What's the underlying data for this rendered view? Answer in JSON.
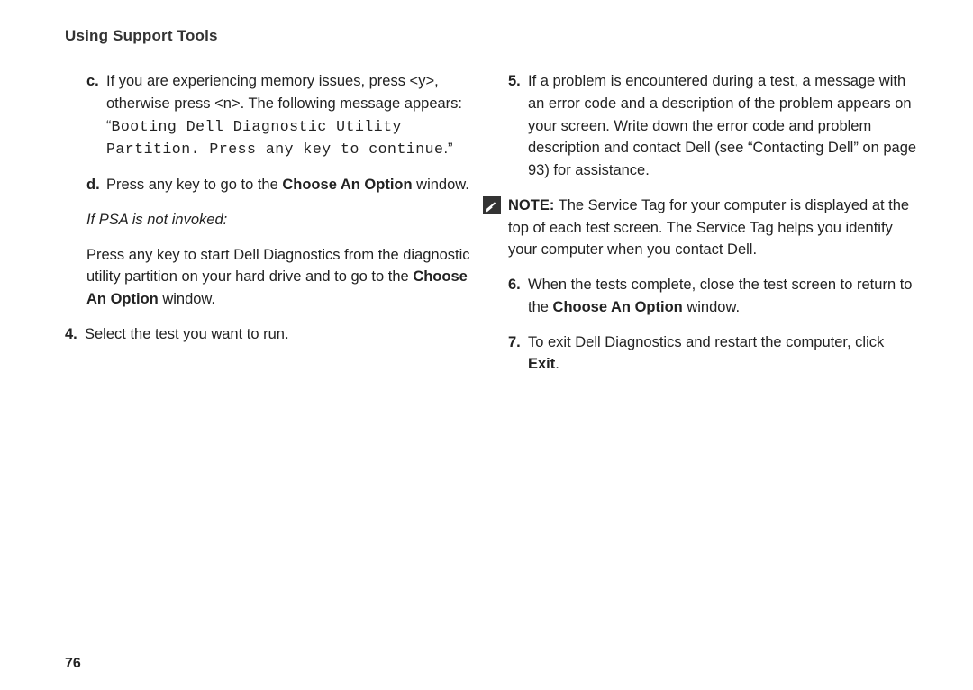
{
  "header": "Using Support Tools",
  "page_number": "76",
  "left": {
    "item_c": {
      "marker": "c.",
      "pre": "If you are experiencing memory issues, press <y>, otherwise press <n>. The following message appears: “",
      "mono": "Booting Dell Diagnostic Utility Partition. Press any key to continue",
      "post": ".”"
    },
    "item_d": {
      "marker": "d.",
      "t1": "Press any key to go to the ",
      "bold": "Choose An Option",
      "t2": " window."
    },
    "psa_heading": "If PSA is not invoked:",
    "psa_body": {
      "t1": "Press any key to start Dell Diagnostics from the diagnostic utility partition on your hard drive and to go to the ",
      "bold": "Choose An Option",
      "t2": " window."
    },
    "item_4": {
      "marker": "4.",
      "text": "Select the test you want to run."
    }
  },
  "right": {
    "item_5": {
      "marker": "5.",
      "text": "If a problem is encountered during a test, a message with an error code and a description of the problem appears on your screen. Write down the error code and problem description and contact Dell (see “Contacting Dell” on page 93) for assistance."
    },
    "note": {
      "label": "NOTE:",
      "text": " The Service Tag for your computer is displayed at the top of each test screen. The Service Tag helps you identify your computer when you contact Dell."
    },
    "item_6": {
      "marker": "6.",
      "t1": "When the tests complete, close the test screen to return to the ",
      "bold": "Choose An Option",
      "t2": " window."
    },
    "item_7": {
      "marker": "7.",
      "t1": "To exit Dell Diagnostics and restart the computer, click ",
      "bold": "Exit",
      "t2": "."
    }
  }
}
